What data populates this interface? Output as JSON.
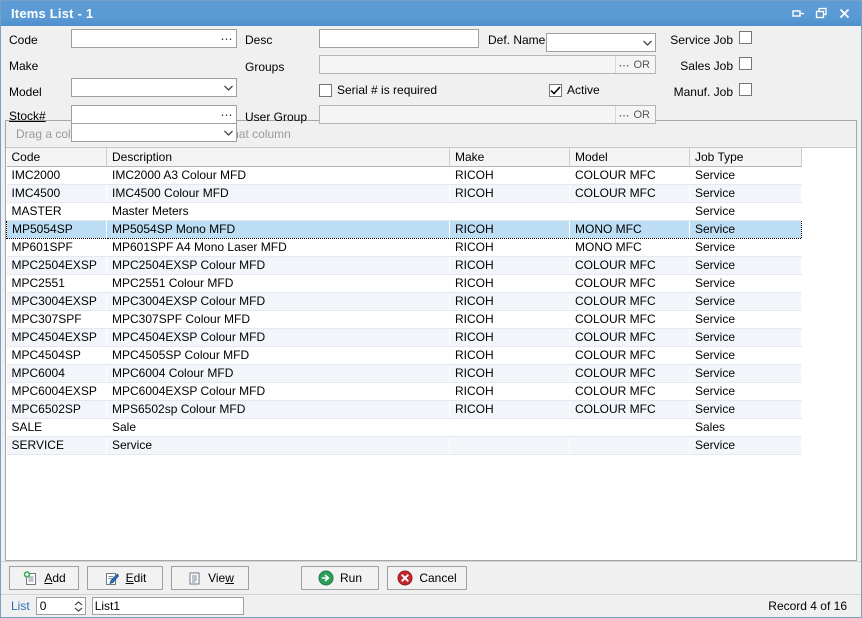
{
  "window": {
    "title": "Items List - 1",
    "titlebar_color": "#5b9bd5",
    "buttons": [
      {
        "name": "auto-hide-pin",
        "tip": "Auto Hide"
      },
      {
        "name": "restore",
        "tip": "Restore"
      },
      {
        "name": "close",
        "tip": "Close"
      }
    ]
  },
  "filters": {
    "code": {
      "label": "Code",
      "value": "",
      "placeholder": ""
    },
    "make": {
      "label": "Make",
      "value": "",
      "placeholder": ""
    },
    "model": {
      "label": "Model",
      "value": "",
      "placeholder": ""
    },
    "stock": {
      "label": "Stock#",
      "value": "",
      "placeholder": ""
    },
    "desc": {
      "label": "Desc",
      "value": "",
      "placeholder": ""
    },
    "groups": {
      "label": "Groups",
      "value": "",
      "or_label": "OR"
    },
    "user_group": {
      "label": "User Group",
      "value": "",
      "or_label": "OR"
    },
    "def_name": {
      "label": "Def. Name",
      "value": ""
    },
    "serial_required": {
      "label": "Serial # is required",
      "checked": false
    },
    "active": {
      "label": "Active",
      "checked": true
    },
    "service_job": {
      "label": "Service Job",
      "checked": false
    },
    "sales_job": {
      "label": "Sales Job",
      "checked": false
    },
    "manuf_job": {
      "label": "Manuf. Job",
      "checked": false
    }
  },
  "grid": {
    "group_hint": "Drag a column header here to group by that column",
    "columns": [
      "Code",
      "Description",
      "Make",
      "Model",
      "Job Type"
    ],
    "selected_index": 3,
    "rows": [
      [
        "IMC2000",
        "IMC2000 A3 Colour MFD",
        "RICOH",
        "COLOUR MFC",
        "Service"
      ],
      [
        "IMC4500",
        "IMC4500  Colour MFD",
        "RICOH",
        "COLOUR MFC",
        "Service"
      ],
      [
        "MASTER",
        "Master Meters",
        "",
        "",
        "Service"
      ],
      [
        "MP5054SP",
        "MP5054SP Mono MFD",
        "RICOH",
        "MONO MFC",
        "Service"
      ],
      [
        "MP601SPF",
        "MP601SPF A4 Mono Laser MFD",
        "RICOH",
        "MONO MFC",
        "Service"
      ],
      [
        "MPC2504EXSP",
        "MPC2504EXSP Colour MFD",
        "RICOH",
        "COLOUR MFC",
        "Service"
      ],
      [
        "MPC2551",
        "MPC2551 Colour MFD",
        "RICOH",
        "COLOUR MFC",
        "Service"
      ],
      [
        "MPC3004EXSP",
        "MPC3004EXSP Colour MFD",
        "RICOH",
        "COLOUR MFC",
        "Service"
      ],
      [
        "MPC307SPF",
        "MPC307SPF Colour MFD",
        "RICOH",
        "COLOUR MFC",
        "Service"
      ],
      [
        "MPC4504EXSP",
        "MPC4504EXSP Colour MFD",
        "RICOH",
        "COLOUR MFC",
        "Service"
      ],
      [
        "MPC4504SP",
        "MPC4505SP Colour MFD",
        "RICOH",
        "COLOUR MFC",
        "Service"
      ],
      [
        "MPC6004",
        "MPC6004 Colour MFD",
        "RICOH",
        "COLOUR MFC",
        "Service"
      ],
      [
        "MPC6004EXSP",
        "MPC6004EXSP Colour MFD",
        "RICOH",
        "COLOUR MFC",
        "Service"
      ],
      [
        "MPC6502SP",
        "MPS6502sp Colour MFD",
        "RICOH",
        "COLOUR MFC",
        "Service"
      ],
      [
        "SALE",
        "Sale",
        "",
        "",
        "Sales"
      ],
      [
        "SERVICE",
        "Service",
        "",
        "",
        "Service"
      ]
    ]
  },
  "toolbar": {
    "add": {
      "label_pre": "",
      "label_accel": "A",
      "label_post": "dd",
      "icon": "document-add-icon"
    },
    "edit": {
      "label_pre": "",
      "label_accel": "E",
      "label_post": "dit",
      "icon": "document-pencil-icon"
    },
    "view": {
      "label_pre": "Vie",
      "label_accel": "w",
      "label_post": "",
      "icon": "document-icon"
    },
    "run": {
      "label": "Run",
      "icon": "green-arrow-icon",
      "color": "#2e9e5b"
    },
    "cancel": {
      "label": "Cancel",
      "icon": "red-x-icon",
      "color": "#c0282d"
    }
  },
  "statusbar": {
    "list_label": "List",
    "list_number": "0",
    "list_name": "List1",
    "record_text": "Record 4 of 16"
  }
}
